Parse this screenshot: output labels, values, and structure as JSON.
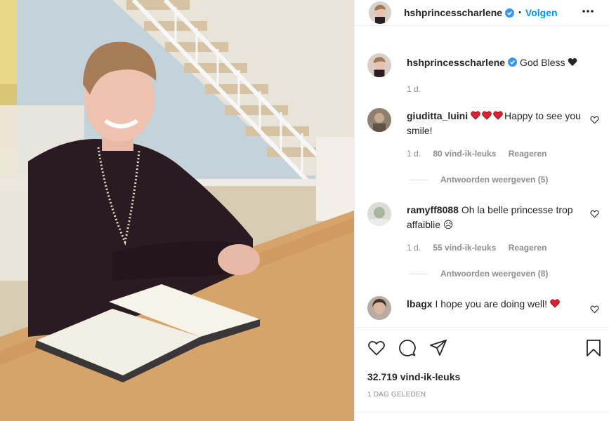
{
  "post": {
    "author": "hshprincesscharlene",
    "follow_label": "Volgen",
    "separator": "•",
    "caption": "God Bless",
    "caption_emoji": "black-heart",
    "caption_time": "1 d."
  },
  "comments": [
    {
      "user": "giuditta_luini",
      "hearts": 3,
      "text": "Happy to see you smile!",
      "time": "1 d.",
      "likes": "80 vind-ik-leuks",
      "reply": "Reageren",
      "view_replies": "Antwoorden weergeven (5)"
    },
    {
      "user": "ramyff8088",
      "text": "Oh la belle princesse trop affaiblie",
      "emoji": "😥",
      "time": "1 d.",
      "likes": "55 vind-ik-leuks",
      "reply": "Reageren",
      "view_replies": "Antwoorden weergeven (8)"
    },
    {
      "user": "lbagx",
      "text": "I hope you are doing well!",
      "trail_emoji": "red-heart"
    }
  ],
  "footer": {
    "likes": "32.719 vind-ik-leuks",
    "posted": "1 DAG GELEDEN"
  },
  "icons": [
    "verified-badge-icon",
    "more-options-icon",
    "like-icon",
    "comment-icon",
    "share-icon",
    "save-icon"
  ],
  "colors": {
    "accent": "#0095f6",
    "verified": "#3897f0",
    "heart": "#ed4956",
    "muted": "#8e8e8e"
  }
}
